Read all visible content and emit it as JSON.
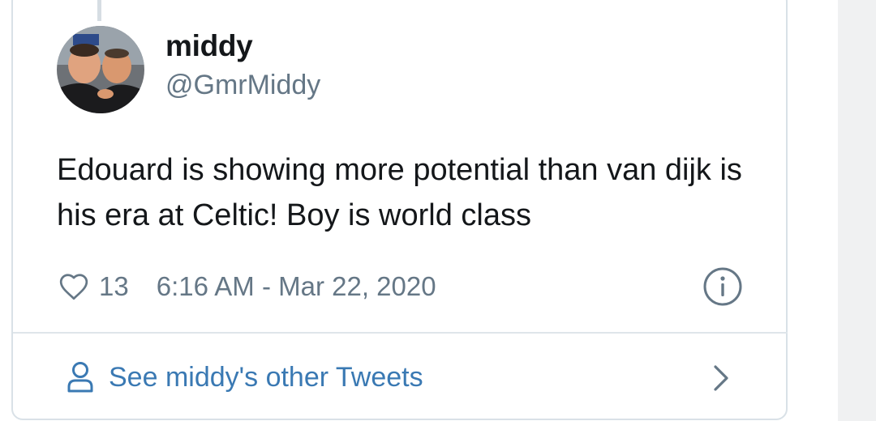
{
  "author": {
    "display_name": "middy",
    "handle": "@GmrMiddy"
  },
  "tweet": {
    "text": "Edouard is showing more potential than van dijk is his era at Celtic! Boy is world class",
    "like_count": "13",
    "timestamp": "6:16 AM - Mar 22, 2020"
  },
  "footer": {
    "link_label": "See middy's other Tweets"
  },
  "icons": {
    "like": "heart-icon",
    "info": "info-icon",
    "profile": "person-icon",
    "more": "chevron-right-icon"
  },
  "colors": {
    "text_primary": "#14171a",
    "text_secondary": "#657786",
    "link": "#3a79b3",
    "border": "#d9e1e7"
  }
}
